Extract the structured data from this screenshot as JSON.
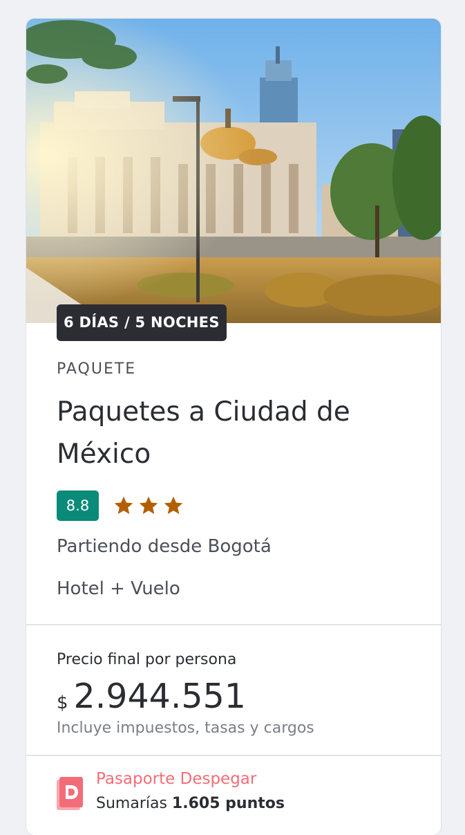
{
  "package": {
    "duration_badge": "6 DÍAS / 5 NOCHES",
    "type_label": "PAQUETE",
    "title": "Paquetes a Ciudad de México",
    "rating_score": "8.8",
    "star_count": 3,
    "origin": "Partiendo desde Bogotá",
    "includes": "Hotel + Vuelo"
  },
  "price": {
    "label": "Precio final por persona",
    "currency_symbol": "$",
    "amount": "2.944.551",
    "taxes_note": "Incluye impuestos, tasas y cargos"
  },
  "passport": {
    "title": "Pasaporte Despegar",
    "points_prefix": "Sumarías",
    "points_value": "1.605 puntos"
  },
  "colors": {
    "score_badge": "#0a8a79",
    "star": "#b35f00",
    "passport_accent": "#f26d78",
    "badge_dark": "#2b2d33"
  },
  "icons": {
    "star": "star-icon",
    "passport": "passport-icon"
  }
}
